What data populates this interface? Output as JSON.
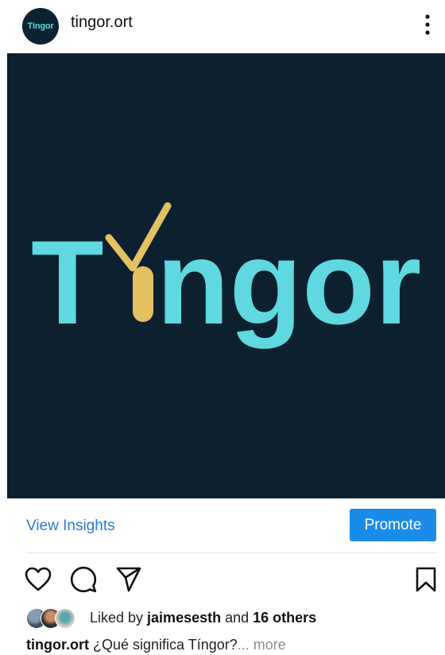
{
  "post": {
    "avatar_text": "Tíngor",
    "username": "tingor.ort",
    "logo": {
      "text_T": "T",
      "text_rest": "ngor",
      "colors": {
        "background": "#0c2030",
        "wordmark": "#5fd8df",
        "accent": "#e3c163"
      }
    }
  },
  "insights": {
    "view_insights_label": "View Insights",
    "promote_label": "Promote"
  },
  "actions": {
    "icons": [
      "heart-icon",
      "comment-icon",
      "share-icon",
      "bookmark-icon"
    ]
  },
  "likes": {
    "prefix": "Liked by ",
    "user": "jaimesesth",
    "and": " and ",
    "others": "16 others"
  },
  "caption": {
    "username": "tingor.ort",
    "text": " ¿Qué significa Tíngor?",
    "more": "... more"
  },
  "colors": {
    "link_blue": "#2b7bd6",
    "promote_blue": "#1a8ce8"
  }
}
